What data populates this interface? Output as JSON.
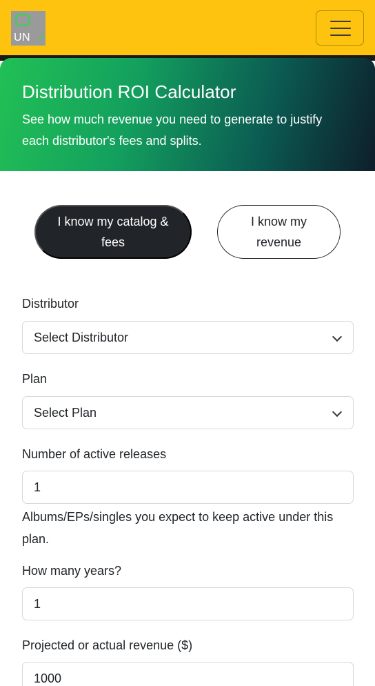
{
  "header": {
    "logo_text": "UN",
    "logo_icon": "un-logo-icon",
    "menu_icon": "hamburger-icon",
    "accent_color": "#fdc30e"
  },
  "hero": {
    "title": "Distribution ROI Calculator",
    "subtitle": "See how much revenue you need to generate to justify each distributor's fees and splits."
  },
  "mode_toggle": {
    "catalog_label": "I know my catalog & fees",
    "revenue_label": "I know my revenue",
    "selected": "catalog"
  },
  "form": {
    "distributor": {
      "label": "Distributor",
      "value": "Select Distributor"
    },
    "plan": {
      "label": "Plan",
      "value": "Select Plan"
    },
    "releases": {
      "label": "Number of active releases",
      "value": "1",
      "help": "Albums/EPs/singles you expect to keep active under this plan."
    },
    "years": {
      "label": "How many years?",
      "value": "1"
    },
    "revenue": {
      "label": "Projected or actual revenue ($)",
      "value": "1000"
    }
  }
}
